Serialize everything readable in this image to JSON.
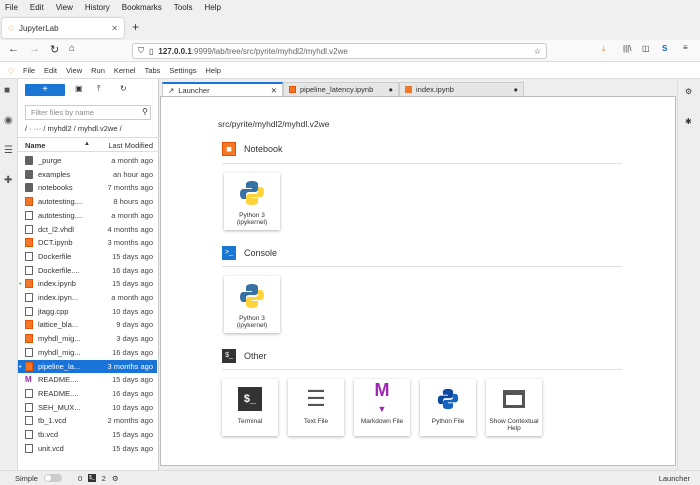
{
  "browser": {
    "menu": [
      "File",
      "Edit",
      "View",
      "History",
      "Bookmarks",
      "Tools",
      "Help"
    ],
    "tab_title": "JupyterLab",
    "url_host": "127.0.0.1",
    "url_rest": ":9999/lab/tree/src/pyrite/myhdl2/myhdl.v2we",
    "profile_letter": "S"
  },
  "jupyter_menu": [
    "File",
    "Edit",
    "View",
    "Run",
    "Kernel",
    "Tabs",
    "Settings",
    "Help"
  ],
  "filebrowser": {
    "new_label": "+",
    "filter_placeholder": "Filter files by name",
    "breadcrumb": "/ · ··· / myhdl2 / myhdl.v2we /",
    "col_name": "Name",
    "col_modified": "Last Modified",
    "files": [
      {
        "name": "_purge",
        "type": "folder",
        "modified": "a month ago"
      },
      {
        "name": "examples",
        "type": "folder",
        "modified": "an hour ago"
      },
      {
        "name": "notebooks",
        "type": "folder",
        "modified": "7 months ago"
      },
      {
        "name": "autotesting....",
        "type": "nb",
        "modified": "8 hours ago"
      },
      {
        "name": "autotesting....",
        "type": "file",
        "modified": "a month ago"
      },
      {
        "name": "dct_l2.vhdl",
        "type": "file",
        "modified": "4 months ago"
      },
      {
        "name": "DCT.ipynb",
        "type": "nb",
        "modified": "3 months ago"
      },
      {
        "name": "Dockerfile",
        "type": "file",
        "modified": "15 days ago"
      },
      {
        "name": "Dockerfile....",
        "type": "file",
        "modified": "16 days ago"
      },
      {
        "name": "index.ipynb",
        "type": "nb",
        "modified": "15 days ago",
        "running": true
      },
      {
        "name": "index.ipyn...",
        "type": "file",
        "modified": "a month ago"
      },
      {
        "name": "jtagg.cpp",
        "type": "file",
        "modified": "10 days ago"
      },
      {
        "name": "lattice_bla...",
        "type": "nb",
        "modified": "9 days ago"
      },
      {
        "name": "myhdl_mig...",
        "type": "nb",
        "modified": "3 days ago"
      },
      {
        "name": "myhdl_mig...",
        "type": "file",
        "modified": "16 days ago"
      },
      {
        "name": "pipeline_la...",
        "type": "nb",
        "modified": "3 months ago",
        "selected": true,
        "running": true
      },
      {
        "name": "README....",
        "type": "md",
        "modified": "15 days ago"
      },
      {
        "name": "README....",
        "type": "file",
        "modified": "16 days ago"
      },
      {
        "name": "SEH_MUX...",
        "type": "file",
        "modified": "10 days ago"
      },
      {
        "name": "tb_1.vcd",
        "type": "file",
        "modified": "2 months ago"
      },
      {
        "name": "tb.vcd",
        "type": "file",
        "modified": "15 days ago"
      },
      {
        "name": "unit.vcd",
        "type": "file",
        "modified": "15 days ago"
      }
    ]
  },
  "tabs": [
    {
      "label": "Launcher",
      "active": true
    },
    {
      "label": "pipeline_latency.ipynb"
    },
    {
      "label": "index.ipynb"
    }
  ],
  "launcher": {
    "path": "src/pyrite/myhdl2/myhdl.v2we",
    "notebook": {
      "title": "Notebook",
      "kernel_line1": "Python 3",
      "kernel_line2": "(ipykernel)"
    },
    "console": {
      "title": "Console",
      "kernel_line1": "Python 3",
      "kernel_line2": "(ipykernel)"
    },
    "other": {
      "title": "Other",
      "items": [
        "Terminal",
        "Text File",
        "Markdown File",
        "Python File",
        "Show Contextual Help"
      ]
    }
  },
  "status": {
    "mode": "Simple",
    "kernels": "0",
    "terminals": "2",
    "right": "Launcher"
  },
  "colors": {
    "accent": "#1976d2",
    "notebook": "#f37726",
    "markdown": "#9c27b0"
  }
}
